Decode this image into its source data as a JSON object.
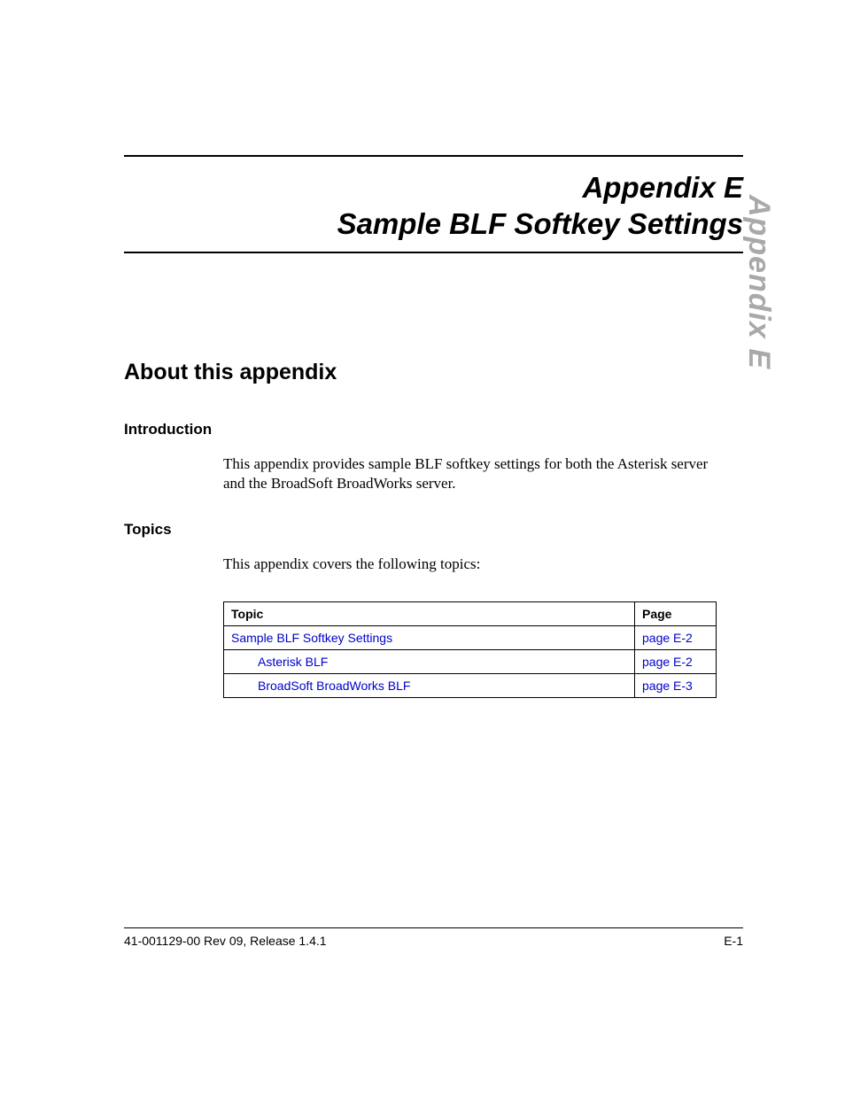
{
  "header": {
    "title_line1": "Appendix E",
    "title_line2": "Sample BLF Softkey Settings"
  },
  "side_tab": "Appendix E",
  "section": {
    "heading": "About this appendix",
    "intro_heading": "Introduction",
    "intro_body": "This appendix provides sample BLF softkey settings for both the Asterisk server and the BroadSoft BroadWorks server.",
    "topics_heading": "Topics",
    "topics_body": "This appendix covers the following topics:"
  },
  "topics_table": {
    "col_topic": "Topic",
    "col_page": "Page",
    "rows": [
      {
        "topic": "Sample BLF Softkey Settings",
        "page": "page E-2",
        "indent": 0
      },
      {
        "topic": "Asterisk BLF",
        "page": "page E-2",
        "indent": 1
      },
      {
        "topic": "BroadSoft BroadWorks BLF",
        "page": "page E-3",
        "indent": 1
      }
    ]
  },
  "footer": {
    "left": "41-001129-00 Rev 09, Release 1.4.1",
    "right": "E-1"
  }
}
